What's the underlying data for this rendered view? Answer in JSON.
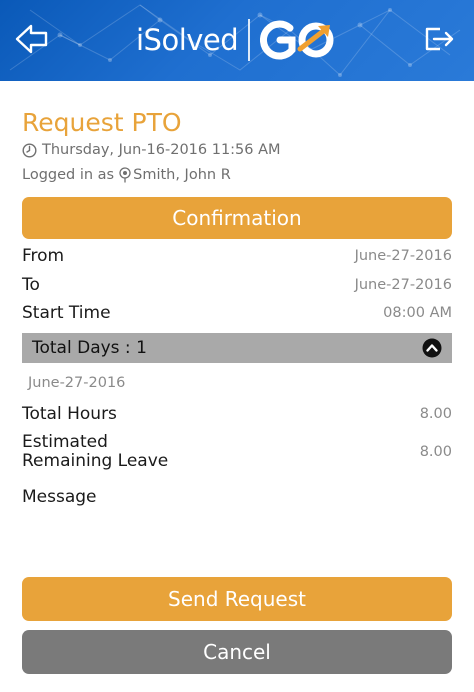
{
  "header": {
    "brand_name": "iSolved",
    "brand_product": "GO",
    "back_icon": "back-arrow-icon",
    "logout_icon": "logout-icon",
    "colors": {
      "header_bg": "#1f6fd0",
      "accent": "#e8a33a",
      "go_arrow": "#f0a030"
    }
  },
  "page": {
    "title": "Request PTO",
    "datetime": "Thursday, Jun-16-2016 11:56 AM",
    "logged_prefix": "Logged in as",
    "user_name": "Smith, John R"
  },
  "confirmation": {
    "label": "Confirmation"
  },
  "details": {
    "from_label": "From",
    "from_value": "June-27-2016",
    "to_label": "To",
    "to_value": "June-27-2016",
    "start_label": "Start Time",
    "start_value": "08:00 AM"
  },
  "days": {
    "label": "Total Days : 1",
    "date": "June-27-2016",
    "toggle_icon": "chevron-up-icon"
  },
  "totals": {
    "hours_label": "Total Hours",
    "hours_value": "8.00",
    "remaining_label_line1": "Estimated",
    "remaining_label_line2": "Remaining Leave",
    "remaining_value": "8.00"
  },
  "message": {
    "label": "Message"
  },
  "actions": {
    "send_label": "Send Request",
    "cancel_label": "Cancel"
  }
}
